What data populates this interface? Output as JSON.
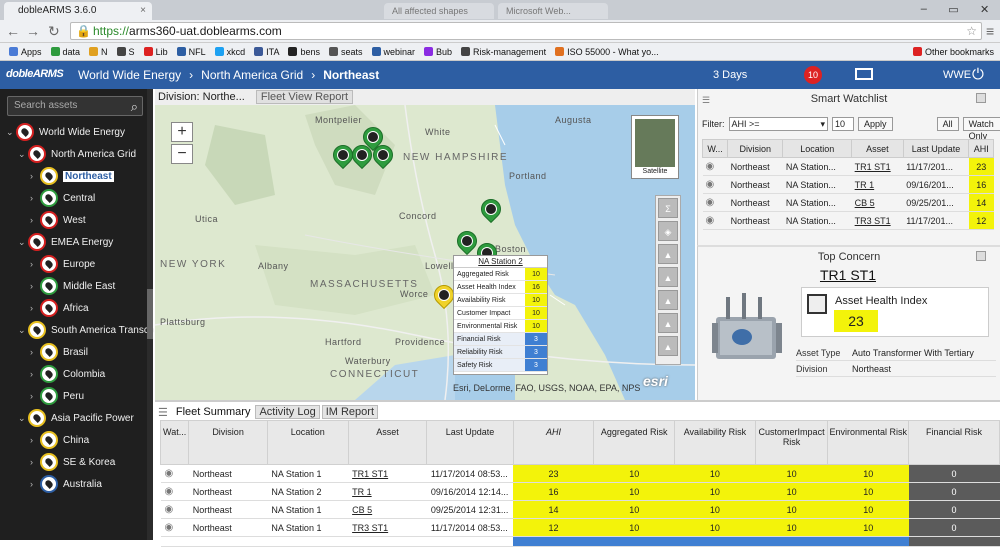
{
  "browser": {
    "tab_title": "dobleARMS 3.6.0",
    "tab_close": "×",
    "other_tabs": [
      "All affected shapes",
      "Microsoft Web..."
    ],
    "url_prefix": "https://",
    "url_host": "arms360-uat.doblearms.com",
    "bookmarks": [
      "Apps",
      "data",
      "N",
      "S",
      "Lib",
      "NFL",
      "xkcd",
      "ITA",
      "bens",
      "seats",
      "webinar",
      "Bub",
      "Risk-management",
      "ISO 55000 - What yo...",
      "Other bookmarks"
    ]
  },
  "app": {
    "logo": "dobleARMS",
    "breadcrumbs": [
      "World Wide Energy",
      "North America Grid",
      "Northeast"
    ],
    "days": "3 Days",
    "alarm_count": "10",
    "user": "WWE"
  },
  "sidebar": {
    "search_placeholder": "Search assets",
    "items": [
      {
        "label": "World Wide Energy",
        "color": "#d42020",
        "level": 0
      },
      {
        "label": "North America Grid",
        "color": "#d42020",
        "level": 1
      },
      {
        "label": "Northeast",
        "color": "#e8c020",
        "level": 2,
        "selected": true
      },
      {
        "label": "Central",
        "color": "#2e9b3e",
        "level": 2
      },
      {
        "label": "West",
        "color": "#d42020",
        "level": 2
      },
      {
        "label": "EMEA Energy",
        "color": "#d42020",
        "level": 1
      },
      {
        "label": "Europe",
        "color": "#d42020",
        "level": 2
      },
      {
        "label": "Middle East",
        "color": "#2e9b3e",
        "level": 2
      },
      {
        "label": "Africa",
        "color": "#d42020",
        "level": 2
      },
      {
        "label": "South America Transco",
        "color": "#e8c020",
        "level": 1
      },
      {
        "label": "Brasil",
        "color": "#e8c020",
        "level": 2
      },
      {
        "label": "Colombia",
        "color": "#2e9b3e",
        "level": 2
      },
      {
        "label": "Peru",
        "color": "#2e9b3e",
        "level": 2
      },
      {
        "label": "Asia Pacific Power",
        "color": "#e8c020",
        "level": 1
      },
      {
        "label": "China",
        "color": "#e8c020",
        "level": 2
      },
      {
        "label": "SE & Korea",
        "color": "#e8c020",
        "level": 2
      },
      {
        "label": "Australia",
        "color": "#2d5ea3",
        "level": 2
      }
    ]
  },
  "map": {
    "title": "Division: Northe...",
    "tab": "Fleet View Report",
    "zoom_in": "+",
    "zoom_out": "−",
    "satellite_label": "Satellite",
    "labels": [
      "Montpelier",
      "Augusta",
      "White",
      "NEW HAMPSHIRE",
      "Portland",
      "Concord",
      "NEW YORK",
      "Albany",
      "Lowell",
      "MASSACHUSETTS",
      "Worce",
      "Hartford",
      "Providence",
      "Waterbury",
      "CONNECTICUT",
      "Boston",
      "Utica",
      "Plattsburg"
    ],
    "attribution": "Esri, DeLorme, FAO, USGS, NOAA, EPA, NPS",
    "esri": "esri",
    "popup": {
      "title": "NA Station 2",
      "rows": [
        {
          "label": "Aggregated Risk",
          "value": "10",
          "color": "yellow"
        },
        {
          "label": "Asset Health Index",
          "value": "16",
          "color": "yellow"
        },
        {
          "label": "Availability Risk",
          "value": "10",
          "color": "yellow"
        },
        {
          "label": "Customer Impact",
          "value": "10",
          "color": "yellow"
        },
        {
          "label": "Environmental Risk",
          "value": "10",
          "color": "yellow"
        },
        {
          "label": "Financial Risk",
          "value": "3",
          "color": "blue"
        },
        {
          "label": "Reliability Risk",
          "value": "3",
          "color": "blue"
        },
        {
          "label": "Safety Risk",
          "value": "3",
          "color": "blue"
        }
      ]
    }
  },
  "watchlist": {
    "title": "Smart Watchlist",
    "filter_label": "Filter:",
    "filter_select": "AHI >=",
    "filter_value": "10",
    "apply": "Apply",
    "all": "All",
    "watch_only": "Watch Only",
    "headers": [
      "W...",
      "Division",
      "Location",
      "Asset",
      "Last Update",
      "AHI"
    ],
    "rows": [
      {
        "division": "Northeast",
        "location": "NA Station...",
        "asset": "TR1 ST1",
        "update": "11/17/201...",
        "ahi": "23"
      },
      {
        "division": "Northeast",
        "location": "NA Station...",
        "asset": "TR 1",
        "update": "09/16/201...",
        "ahi": "16"
      },
      {
        "division": "Northeast",
        "location": "NA Station...",
        "asset": "CB 5",
        "update": "09/25/201...",
        "ahi": "14"
      },
      {
        "division": "Northeast",
        "location": "NA Station...",
        "asset": "TR3 ST1",
        "update": "11/17/201...",
        "ahi": "12"
      }
    ]
  },
  "concern": {
    "title": "Top Concern",
    "asset": "TR1 ST1",
    "metric_label": "Asset Health Index",
    "metric_value": "23",
    "fields": [
      {
        "key": "Asset Type",
        "value": "Auto Transformer With Tertiary"
      },
      {
        "key": "Division",
        "value": "Northeast"
      }
    ]
  },
  "fleet": {
    "tabs": [
      "Fleet Summary",
      "Activity Log",
      "IM Report"
    ],
    "headers": [
      "Wat...",
      "Division",
      "Location",
      "Asset",
      "Last Update",
      "AHI",
      "Aggregated Risk",
      "Availability Risk",
      "CustomerImpact Risk",
      "Environmental Risk",
      "Financial Risk"
    ],
    "rows": [
      {
        "division": "Northeast",
        "location": "NA Station 1",
        "asset": "TR1 ST1",
        "update": "11/17/2014 08:53...",
        "ahi": "23",
        "agg": "10",
        "avail": "10",
        "cust": "10",
        "env": "10",
        "fin": "0"
      },
      {
        "division": "Northeast",
        "location": "NA Station 2",
        "asset": "TR 1",
        "update": "09/16/2014 12:14...",
        "ahi": "16",
        "agg": "10",
        "avail": "10",
        "cust": "10",
        "env": "10",
        "fin": "0"
      },
      {
        "division": "Northeast",
        "location": "NA Station 1",
        "asset": "CB 5",
        "update": "09/25/2014 12:31...",
        "ahi": "14",
        "agg": "10",
        "avail": "10",
        "cust": "10",
        "env": "10",
        "fin": "0"
      },
      {
        "division": "Northeast",
        "location": "NA Station 1",
        "asset": "TR3 ST1",
        "update": "11/17/2014 08:53...",
        "ahi": "12",
        "agg": "10",
        "avail": "10",
        "cust": "10",
        "env": "10",
        "fin": "0"
      }
    ]
  }
}
